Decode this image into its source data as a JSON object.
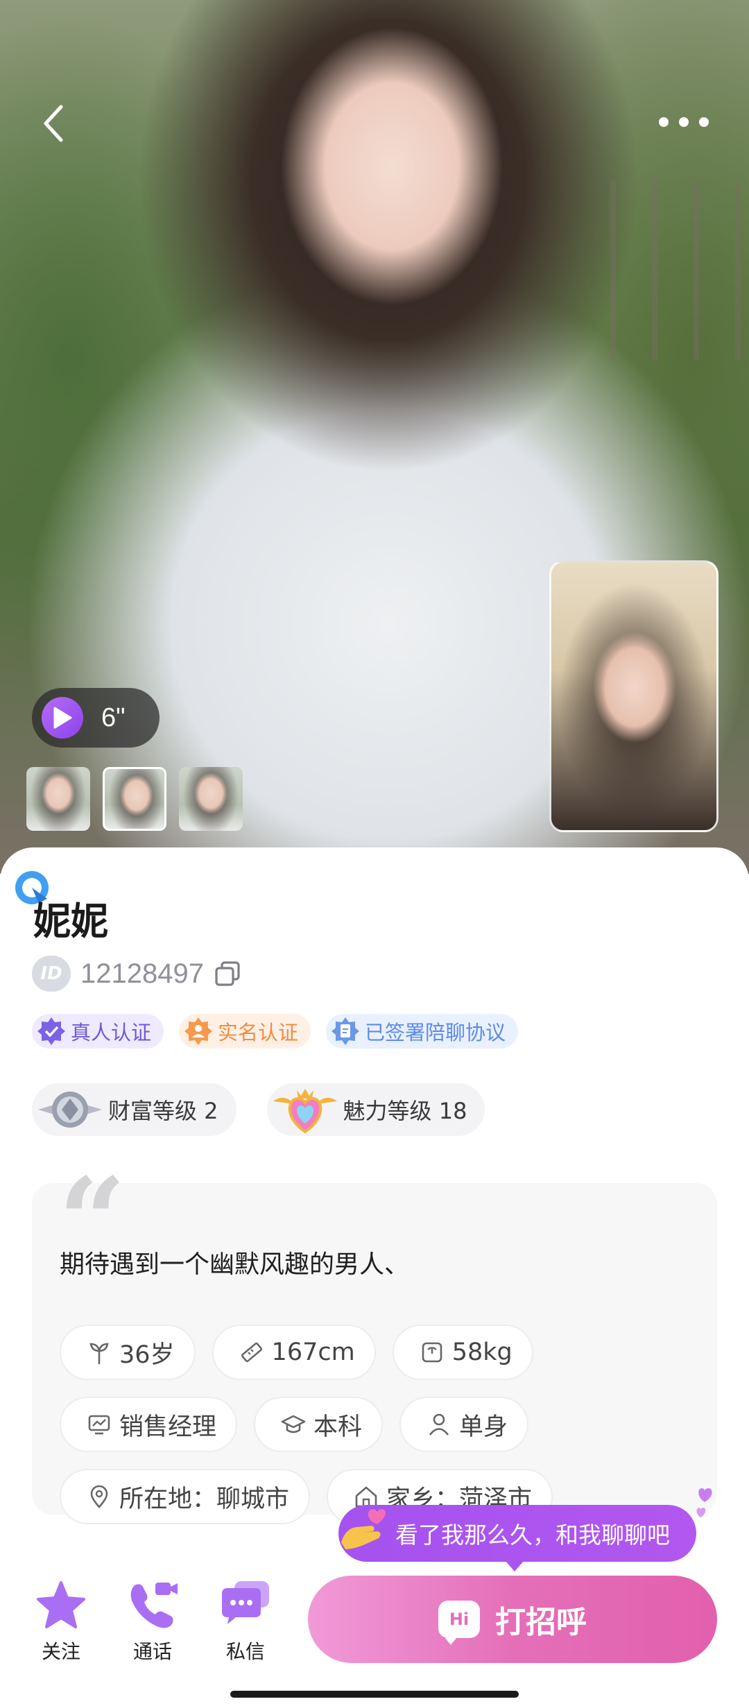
{
  "profile": {
    "name": "妮妮",
    "id_badge": "ID",
    "id_number": "12128497"
  },
  "video": {
    "duration": "6\""
  },
  "badges": [
    {
      "label": "真人认证",
      "color": "#6f58d9"
    },
    {
      "label": "实名认证",
      "color": "#f58b3d"
    },
    {
      "label": "已签署陪聊协议",
      "color": "#5d8be6"
    }
  ],
  "levels": {
    "wealth": "财富等级 2",
    "charm": "魅力等级 18"
  },
  "bio": {
    "quote_mark": "“",
    "text": "期待遇到一个幽默风趣的男人、",
    "tags": {
      "age": "36岁",
      "height": "167cm",
      "weight": "58kg",
      "job": "销售经理",
      "education": "本科",
      "marital": "单身",
      "location": "所在地：聊城市",
      "hometown": "家乡：菏泽市"
    }
  },
  "hint": {
    "text": "看了我那么久，和我聊聊吧"
  },
  "bottom_bar": {
    "follow": "关注",
    "call": "通话",
    "message": "私信",
    "greet_icon": "Hi",
    "greet": "打招呼"
  },
  "colors": {
    "accent_purple": "#8d43ea",
    "greet_pink": "#e46fb8"
  }
}
